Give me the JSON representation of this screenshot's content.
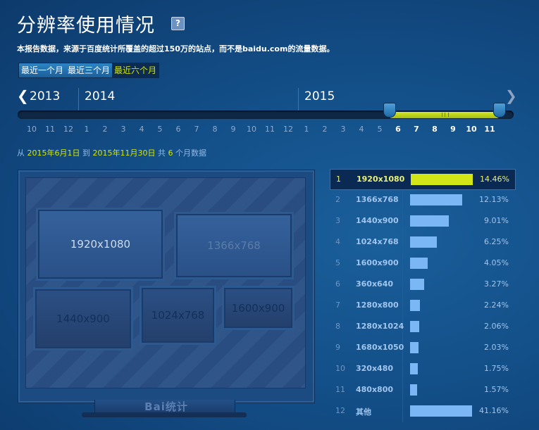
{
  "header": {
    "title": "分辨率使用情况",
    "help_icon": "?",
    "subtitle": "本报告数据，来源于百度统计所覆盖的超过150万的站点，而不是baidu.com的流量数据。"
  },
  "range_tabs": [
    {
      "label": "最近一个月",
      "active": false
    },
    {
      "label": "最近三个月",
      "active": false
    },
    {
      "label": "最近六个月",
      "active": true
    }
  ],
  "timeline": {
    "years": [
      "2013",
      "2014",
      "2015"
    ],
    "months": [
      "10",
      "11",
      "12",
      "1",
      "2",
      "3",
      "4",
      "5",
      "6",
      "7",
      "8",
      "9",
      "10",
      "11",
      "12",
      "1",
      "2",
      "3",
      "4",
      "5",
      "6",
      "7",
      "8",
      "9",
      "10",
      "11"
    ],
    "selected_start": "6",
    "selected_end": "11"
  },
  "period": {
    "from_label": "从",
    "start_date": "2015年6月1日",
    "to_label": "到",
    "end_date": "2015年11月30日",
    "total_label": "共",
    "count": "6",
    "unit_label": "个月数据"
  },
  "monitor": {
    "tiles": [
      "1920x1080",
      "1366x768",
      "1440x900",
      "1024x768",
      "1600x900"
    ],
    "brand": "Bai统计"
  },
  "ranking": [
    {
      "rank": "1",
      "name": "1920x1080",
      "value": 14.46,
      "pct": "14.46%",
      "active": true
    },
    {
      "rank": "2",
      "name": "1366x768",
      "value": 12.13,
      "pct": "12.13%"
    },
    {
      "rank": "3",
      "name": "1440x900",
      "value": 9.01,
      "pct": "9.01%"
    },
    {
      "rank": "4",
      "name": "1024x768",
      "value": 6.25,
      "pct": "6.25%"
    },
    {
      "rank": "5",
      "name": "1600x900",
      "value": 4.05,
      "pct": "4.05%"
    },
    {
      "rank": "6",
      "name": "360x640",
      "value": 3.27,
      "pct": "3.27%"
    },
    {
      "rank": "7",
      "name": "1280x800",
      "value": 2.24,
      "pct": "2.24%"
    },
    {
      "rank": "8",
      "name": "1280x1024",
      "value": 2.06,
      "pct": "2.06%"
    },
    {
      "rank": "9",
      "name": "1680x1050",
      "value": 2.03,
      "pct": "2.03%"
    },
    {
      "rank": "10",
      "name": "320x480",
      "value": 1.75,
      "pct": "1.75%"
    },
    {
      "rank": "11",
      "name": "480x800",
      "value": 1.57,
      "pct": "1.57%"
    },
    {
      "rank": "12",
      "name": "其他",
      "value": 41.16,
      "pct": "41.16%"
    }
  ],
  "colors": {
    "accent": "#d4e600",
    "bar": "#7bb7f5",
    "background": "#134f88"
  }
}
